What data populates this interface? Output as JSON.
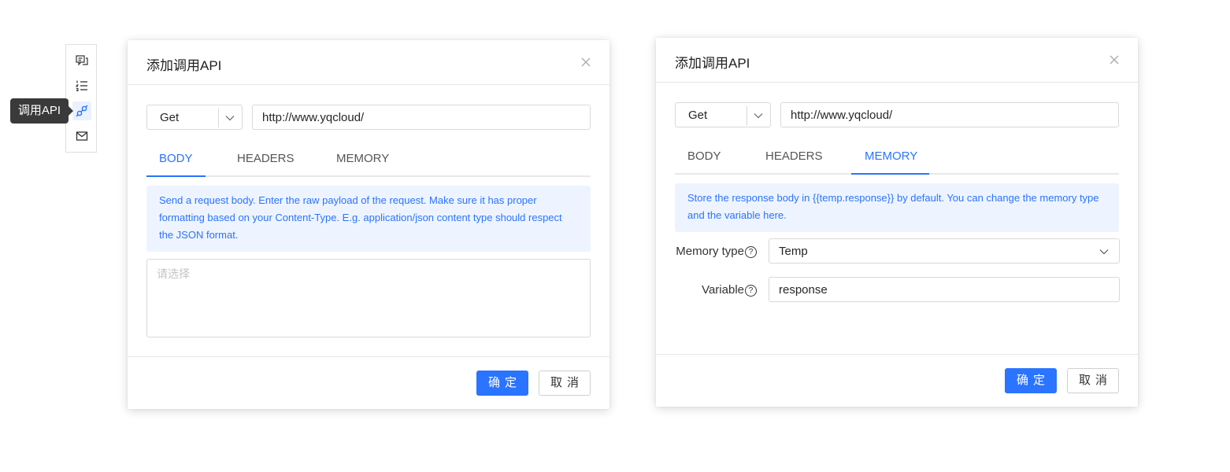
{
  "toolbar": {
    "tooltip": "调用API",
    "items": [
      {
        "icon": "chat-messages-icon"
      },
      {
        "icon": "ordered-list-icon"
      },
      {
        "icon": "api-link-icon",
        "active": true
      },
      {
        "icon": "mail-icon"
      }
    ]
  },
  "dialog_left": {
    "title": "添加调用API",
    "method": "Get",
    "url": "http://www.yqcloud/",
    "tabs": [
      "BODY",
      "HEADERS",
      "MEMORY"
    ],
    "active_tab": "BODY",
    "info": "Send a request body. Enter the raw payload of the request. Make sure it has proper formatting based on your Content-Type. E.g. application/json content type should respect the JSON format.",
    "body_placeholder": "请选择",
    "ok_label": "确定",
    "cancel_label": "取消"
  },
  "dialog_right": {
    "title": "添加调用API",
    "method": "Get",
    "url": "http://www.yqcloud/",
    "tabs": [
      "BODY",
      "HEADERS",
      "MEMORY"
    ],
    "active_tab": "MEMORY",
    "info": "Store the response body in {{temp.response}} by default. You can change the memory type and the variable here.",
    "memory_type_label": "Memory type",
    "memory_type_value": "Temp",
    "variable_label": "Variable",
    "variable_value": "response",
    "ok_label": "确定",
    "cancel_label": "取消"
  },
  "colors": {
    "accent": "#2a74ff",
    "info_bg": "#eef4ff"
  }
}
